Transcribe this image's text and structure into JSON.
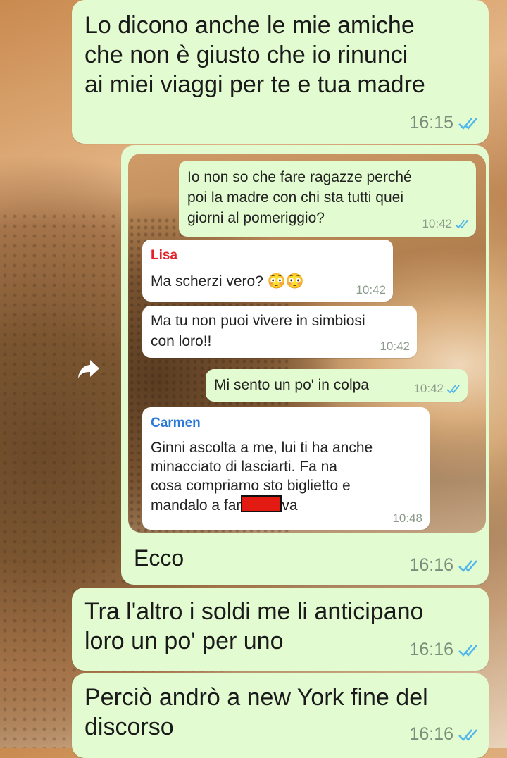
{
  "messages": [
    {
      "text_lines": [
        "Lo dicono anche le mie amiche",
        "che non è giusto che io rinunci",
        "ai miei viaggi per te e tua madre"
      ],
      "time": "16:15"
    },
    {
      "caption": "Ecco",
      "time": "16:16"
    },
    {
      "text_lines": [
        "Tra l'altro i soldi me li anticipano",
        "loro un po' per uno"
      ],
      "time": "16:16"
    },
    {
      "text_lines": [
        "Perciò andrò a new York fine del",
        "discorso"
      ],
      "time": "16:16"
    }
  ],
  "screenshot": {
    "messages": [
      {
        "direction": "out",
        "lines": [
          "Io non so che fare ragazze perché",
          "poi la madre con chi sta tutti quei",
          "giorni al pomeriggio?"
        ],
        "time": "10:42"
      },
      {
        "direction": "in",
        "sender": "Lisa",
        "lines": [
          "Ma scherzi vero? 😳😳"
        ],
        "time": "10:42"
      },
      {
        "direction": "in",
        "lines": [
          "Ma tu non puoi vivere in simbiosi",
          "con loro!!"
        ],
        "time": "10:42"
      },
      {
        "direction": "out",
        "lines": [
          "Mi sento un po' in colpa"
        ],
        "time": "10:42"
      },
      {
        "direction": "in",
        "sender": "Carmen",
        "lines": [
          "Ginni ascolta a me, lui ti ha anche",
          "minacciato di lasciarti. Fa na",
          "cosa compriamo sto biglietto e"
        ],
        "last_line_start": "mandalo a far",
        "last_line_end": "va",
        "time": "10:48"
      }
    ]
  },
  "colors": {
    "outgoing_bubble": "#e2fbd0",
    "incoming_bubble": "#ffffff",
    "read_tick": "#4fb6ec",
    "lisa_name": "#e0242c",
    "carmen_name": "#2b7bd6",
    "redaction": "#e21a12"
  },
  "icons": {
    "forward": "forward-arrow-icon",
    "read": "double-check-icon"
  }
}
